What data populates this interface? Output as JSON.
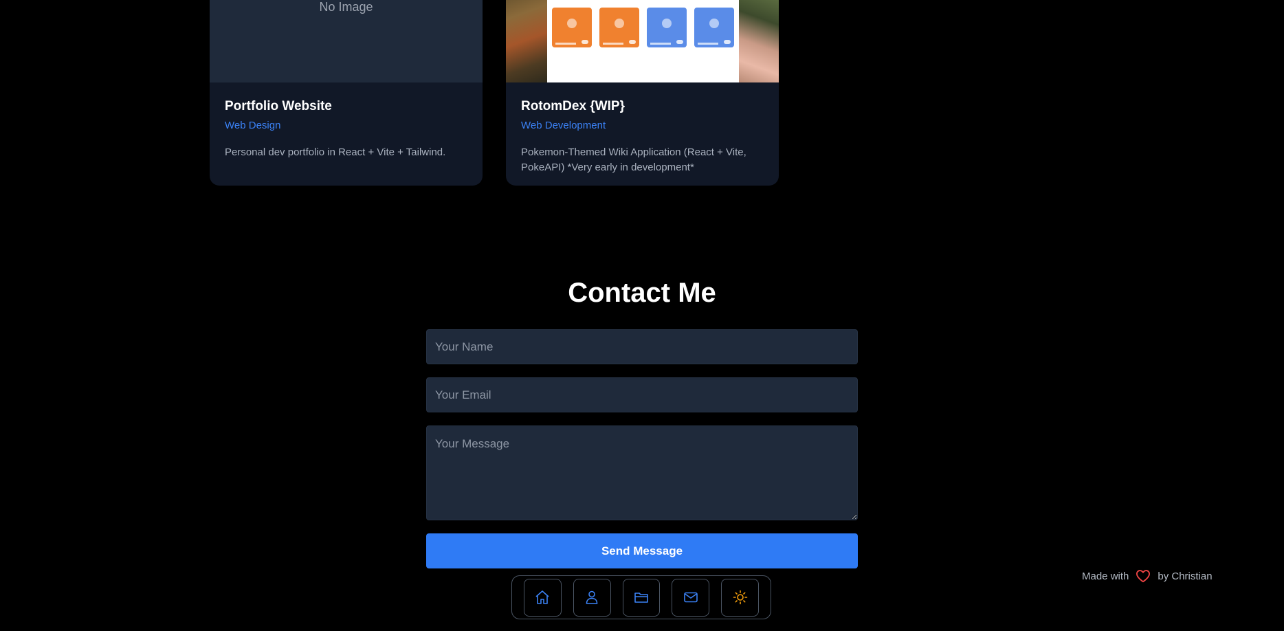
{
  "projects": [
    {
      "image_placeholder": "No Image",
      "title": "Portfolio Website",
      "category": "Web Design",
      "description": "Personal dev portfolio in React + Vite + Tailwind."
    },
    {
      "title": "RotomDex {WIP}",
      "category": "Web Development",
      "description": "Pokemon-Themed Wiki Application (React + Vite, PokeAPI) *Very early in development*"
    }
  ],
  "contact": {
    "title": "Contact Me",
    "name_placeholder": "Your Name",
    "email_placeholder": "Your Email",
    "message_placeholder": "Your Message",
    "name_value": "",
    "email_value": "",
    "message_value": "",
    "submit_label": "Send Message"
  },
  "dock": {
    "items": [
      "home-icon",
      "user-icon",
      "folder-icon",
      "mail-icon",
      "sun-icon"
    ]
  },
  "footer": {
    "prefix": "Made with",
    "suffix": "by Christian"
  },
  "colors": {
    "accent": "#2f7bf5",
    "category_text": "#3b82f6",
    "heart": "#ef4444",
    "sun": "#f59e0b",
    "card_bg": "#111827",
    "input_bg": "#1f2a3b"
  }
}
